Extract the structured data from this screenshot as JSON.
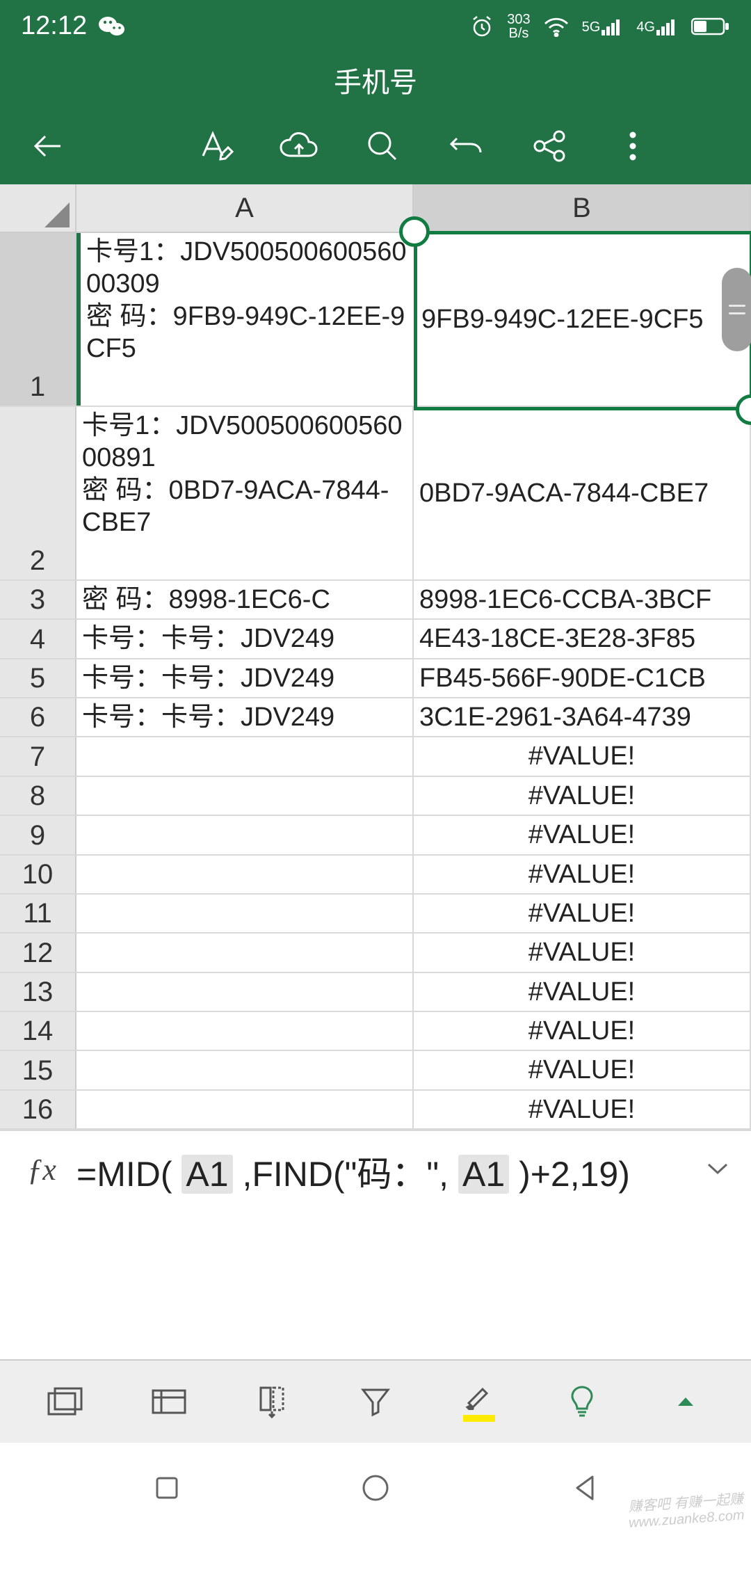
{
  "status": {
    "time": "12:12",
    "net_speed": "303",
    "net_unit": "B/s",
    "net1": "5G",
    "net2": "4G"
  },
  "title": "手机号",
  "columns": [
    "A",
    "B"
  ],
  "rows": [
    {
      "n": "1",
      "A": "卡号1：JDV50050060056000309\n密 码：9FB9-949C-12EE-9CF5",
      "B": "9FB9-949C-12EE-9CF5",
      "tall": 250
    },
    {
      "n": "2",
      "A": "卡号1：JDV50050060056000891\n密 码：0BD7-9ACA-7844-CBE7",
      "B": "0BD7-9ACA-7844-CBE7",
      "tall": 250
    },
    {
      "n": "3",
      "A": "密 码：8998-1EC6-C",
      "B": "8998-1EC6-CCBA-3BCF"
    },
    {
      "n": "4",
      "A": "卡号：卡号：JDV249",
      "B": "4E43-18CE-3E28-3F85"
    },
    {
      "n": "5",
      "A": "卡号：卡号：JDV249",
      "B": "FB45-566F-90DE-C1CB"
    },
    {
      "n": "6",
      "A": "卡号：卡号：JDV249",
      "B": "3C1E-2961-3A64-4739"
    },
    {
      "n": "7",
      "A": "",
      "B": "#VALUE!"
    },
    {
      "n": "8",
      "A": "",
      "B": "#VALUE!"
    },
    {
      "n": "9",
      "A": "",
      "B": "#VALUE!"
    },
    {
      "n": "10",
      "A": "",
      "B": "#VALUE!"
    },
    {
      "n": "11",
      "A": "",
      "B": "#VALUE!"
    },
    {
      "n": "12",
      "A": "",
      "B": "#VALUE!"
    },
    {
      "n": "13",
      "A": "",
      "B": "#VALUE!"
    },
    {
      "n": "14",
      "A": "",
      "B": "#VALUE!"
    },
    {
      "n": "15",
      "A": "",
      "B": "#VALUE!"
    },
    {
      "n": "16",
      "A": "",
      "B": "#VALUE!"
    }
  ],
  "formula": {
    "pre1": "=MID(",
    "ref1": "A1",
    "mid1": ",FIND(\"码：\",",
    "ref2": "A1",
    "post": ")+2,19)"
  },
  "watermark": "赚客吧 有赚一起赚\nwww.zuanke8.com"
}
